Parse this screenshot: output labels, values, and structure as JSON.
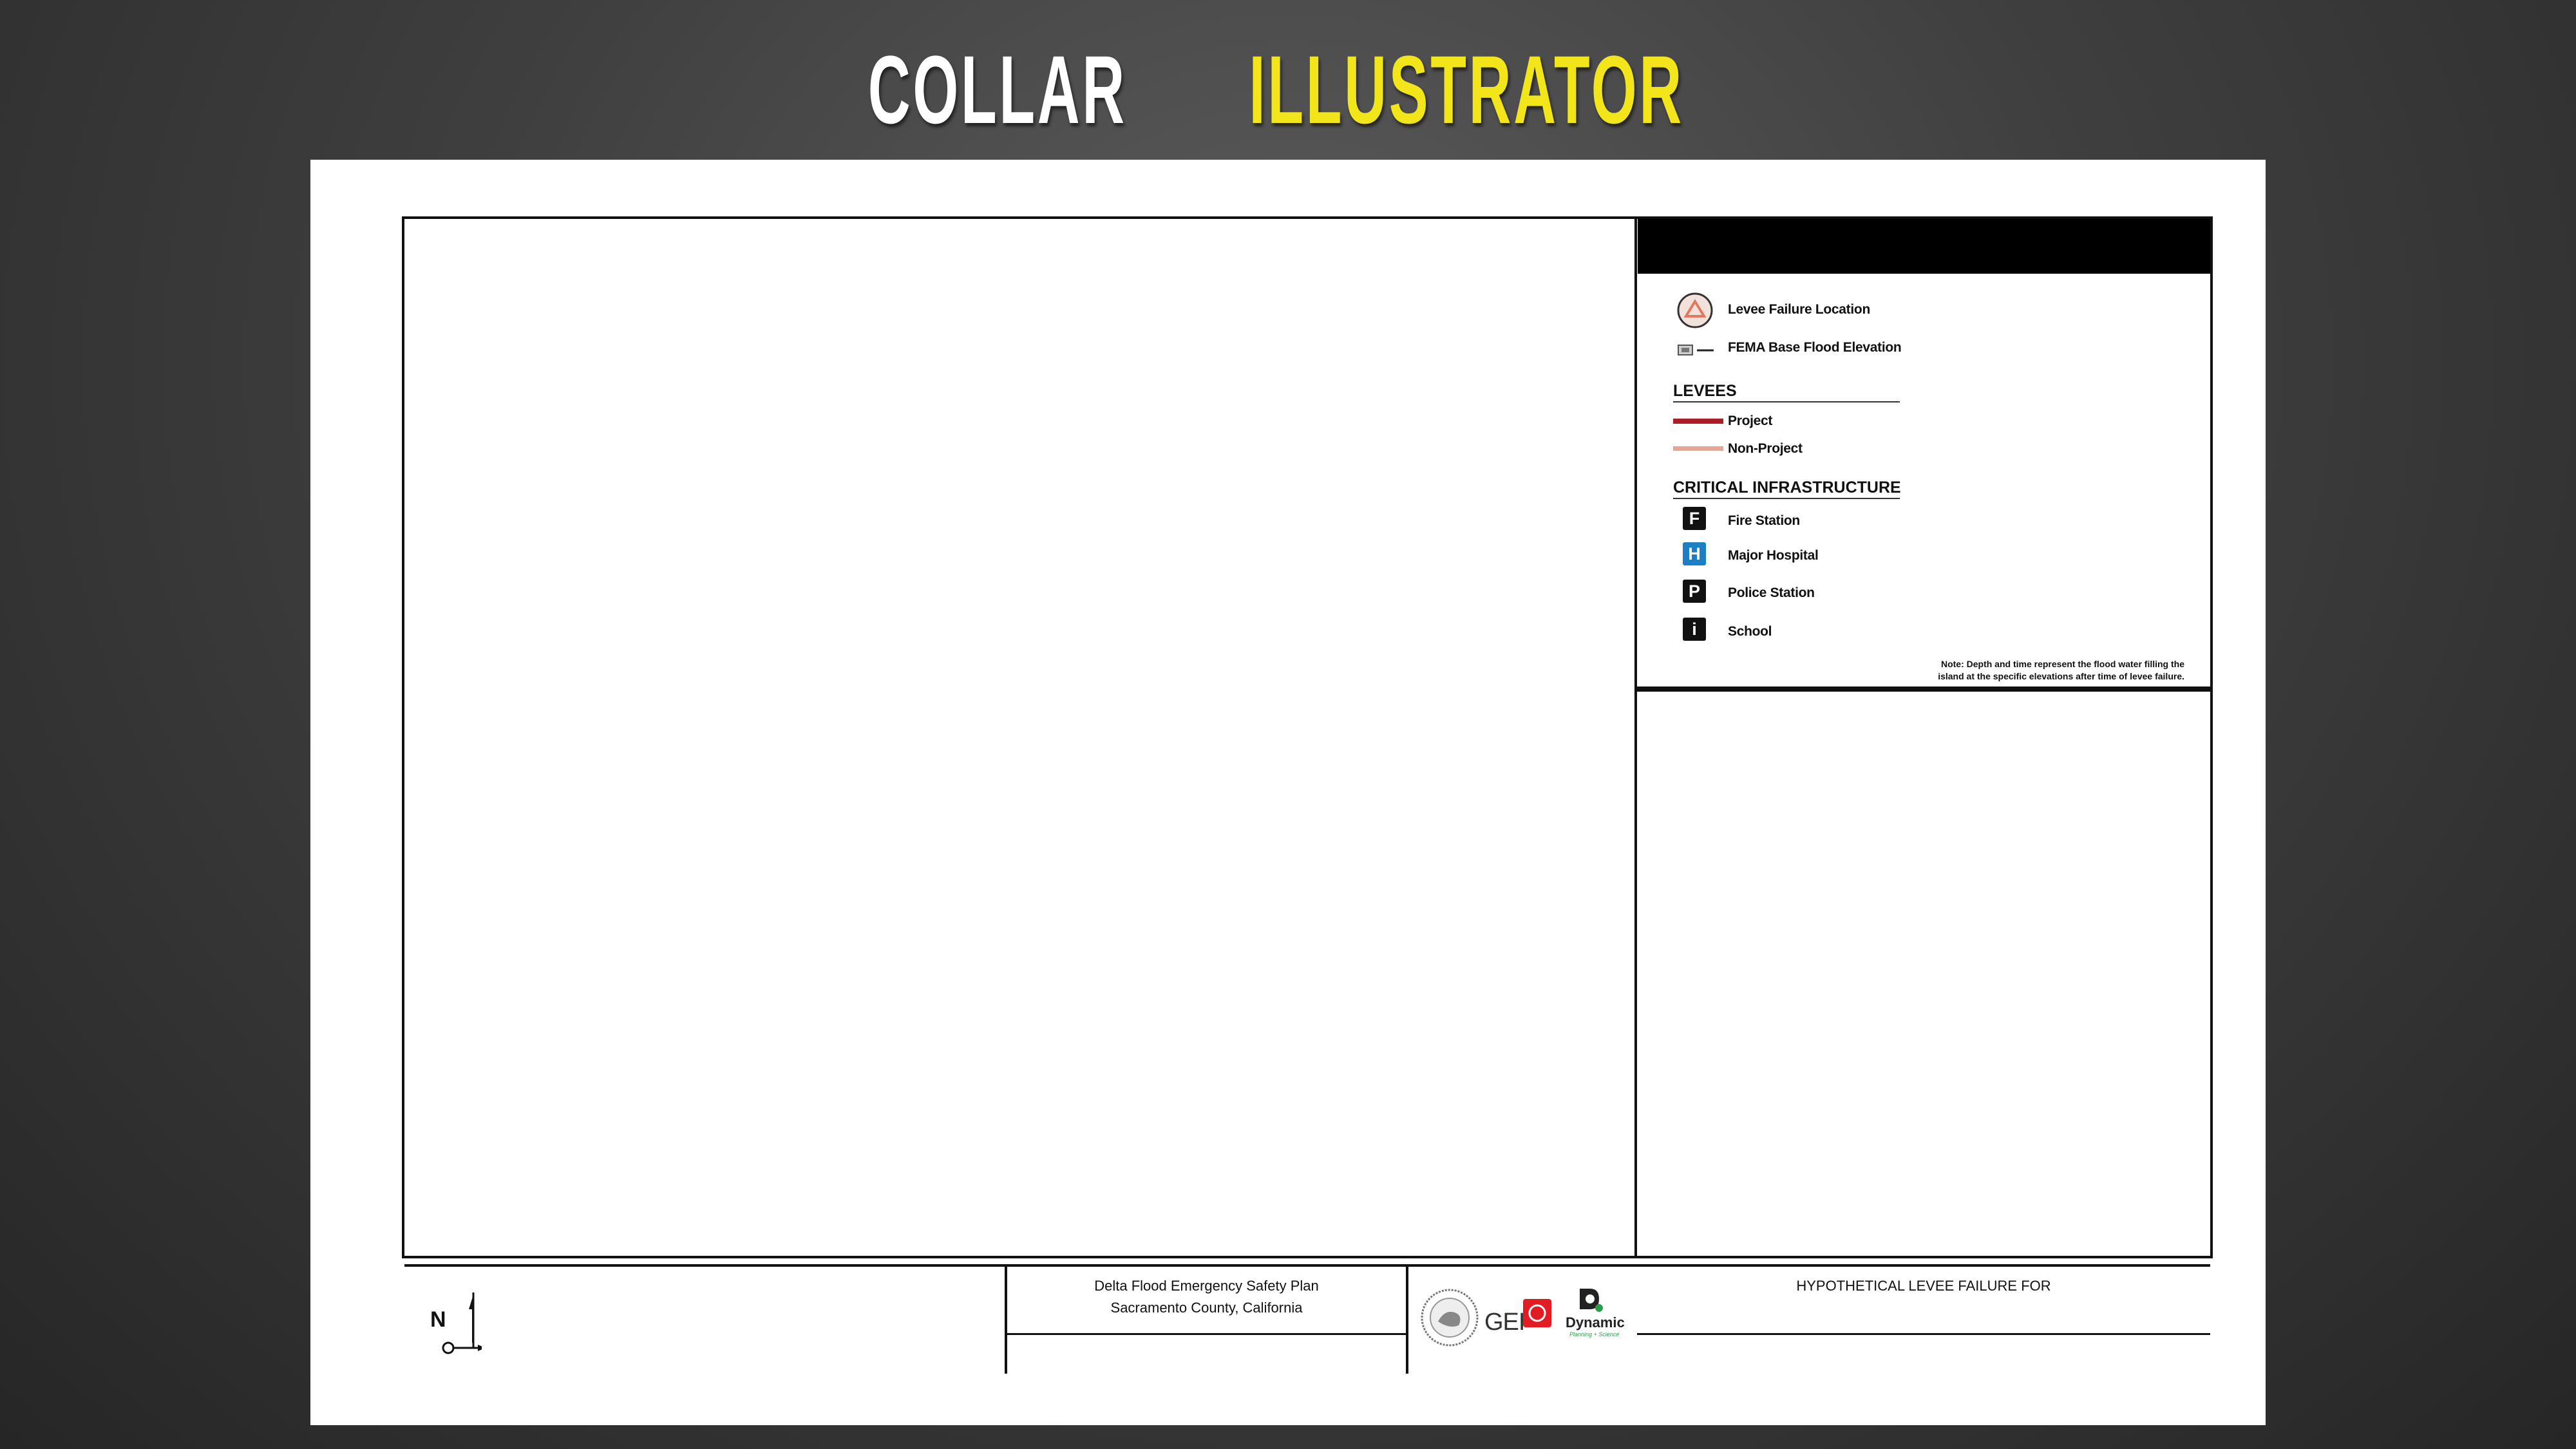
{
  "header": {
    "title_white": "COLLAR",
    "title_yellow": "ILLUSTRATOR"
  },
  "legend": {
    "levee_failure_location": "Levee Failure Location",
    "fema_bfe": "FEMA Base Flood Elevation",
    "levees_heading": "LEVEES",
    "levees": [
      {
        "label": "Project",
        "color": "#b01c24"
      },
      {
        "label": "Non-Project",
        "color": "#e8a593"
      }
    ],
    "critical_heading": "CRITICAL INFRASTRUCTURE",
    "infrastructure": [
      {
        "label": "Fire Station",
        "letter": "F",
        "color": "#111111"
      },
      {
        "label": "Major Hospital",
        "letter": "H",
        "color": "#1a7fc4"
      },
      {
        "label": "Police Station",
        "letter": "P",
        "color": "#111111"
      },
      {
        "label": "School",
        "letter": "i",
        "color": "#111111"
      }
    ],
    "note_line1": "Note: Depth and time represent the flood water filling the",
    "note_line2": "island at the specific elevations after time of levee failure."
  },
  "title_block": {
    "north_label": "N",
    "plan_line1": "Delta Flood Emergency Safety Plan",
    "plan_line2": "Sacramento County, California",
    "logo_gei": "GEI",
    "logo_dynamic": "Dynamic",
    "logo_dynamic_tag": "Planning + Science",
    "failure_title": "HYPOTHETICAL LEVEE FAILURE FOR"
  },
  "colors": {
    "title_yellow": "#f2e51a",
    "project_levee": "#b01c24",
    "non_project_levee": "#e8a593",
    "hospital_blue": "#1a7fc4",
    "levee_failure_icon": "#e07a5f"
  }
}
